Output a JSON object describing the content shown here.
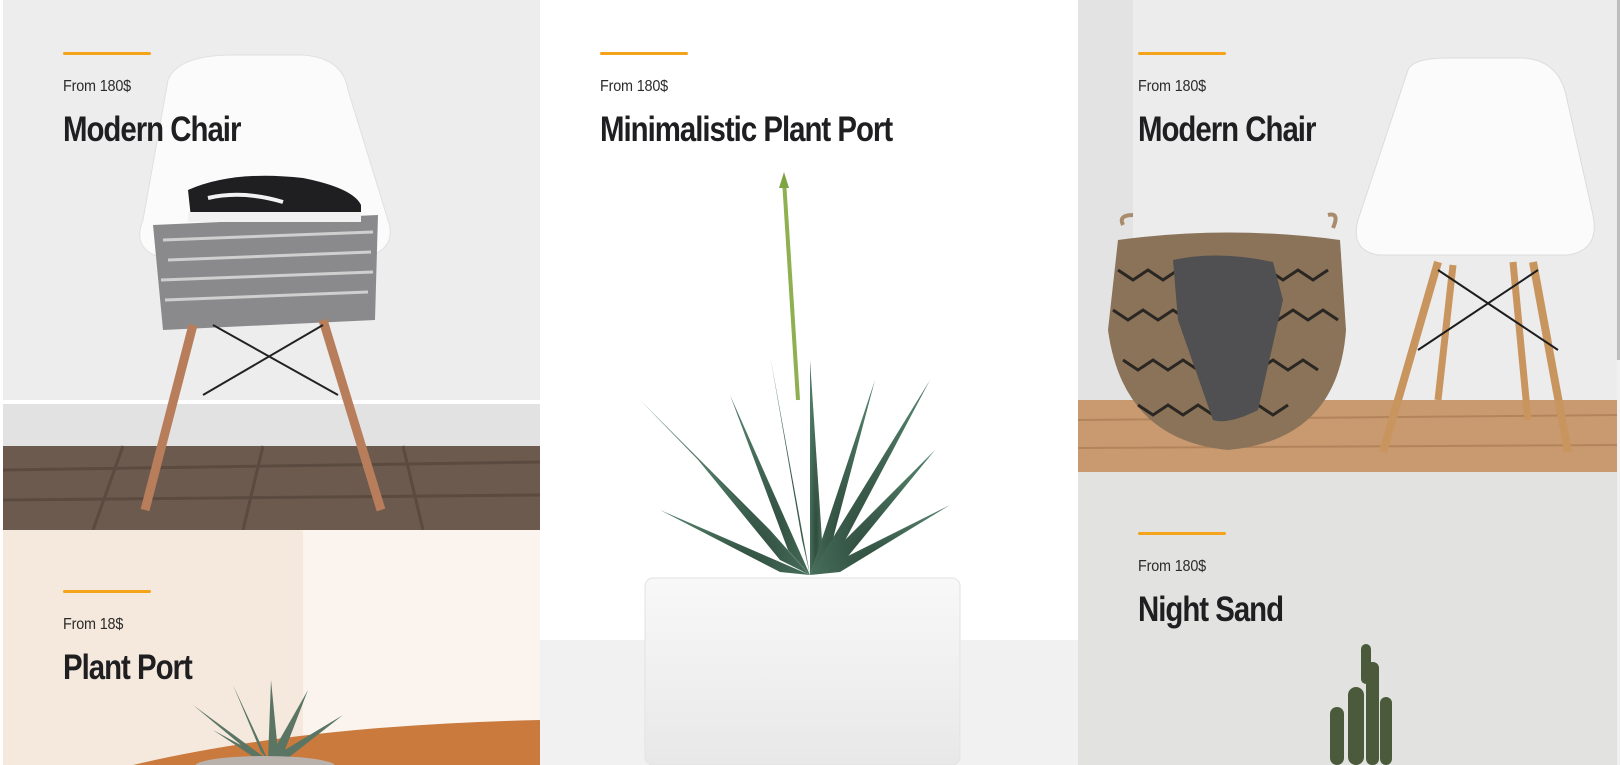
{
  "theme": {
    "accent": "#f5a31a",
    "title_color": "#1f1f22"
  },
  "products": [
    {
      "price": "From 180$",
      "name": "Modern Chair",
      "image": "white-chair-with-sneakers-and-blanket"
    },
    {
      "price": "From 180$",
      "name": "Minimalistic Plant Port",
      "image": "aloe-plant-in-white-pot"
    },
    {
      "price": "From 180$",
      "name": "Modern Chair",
      "image": "white-chair-with-woven-basket"
    },
    {
      "price": "From 18$",
      "name": "Plant Port",
      "image": "succulent-on-wooden-table"
    },
    {
      "price": "From 180$",
      "name": "Night Sand",
      "image": "cactus-on-grey-wall"
    }
  ]
}
